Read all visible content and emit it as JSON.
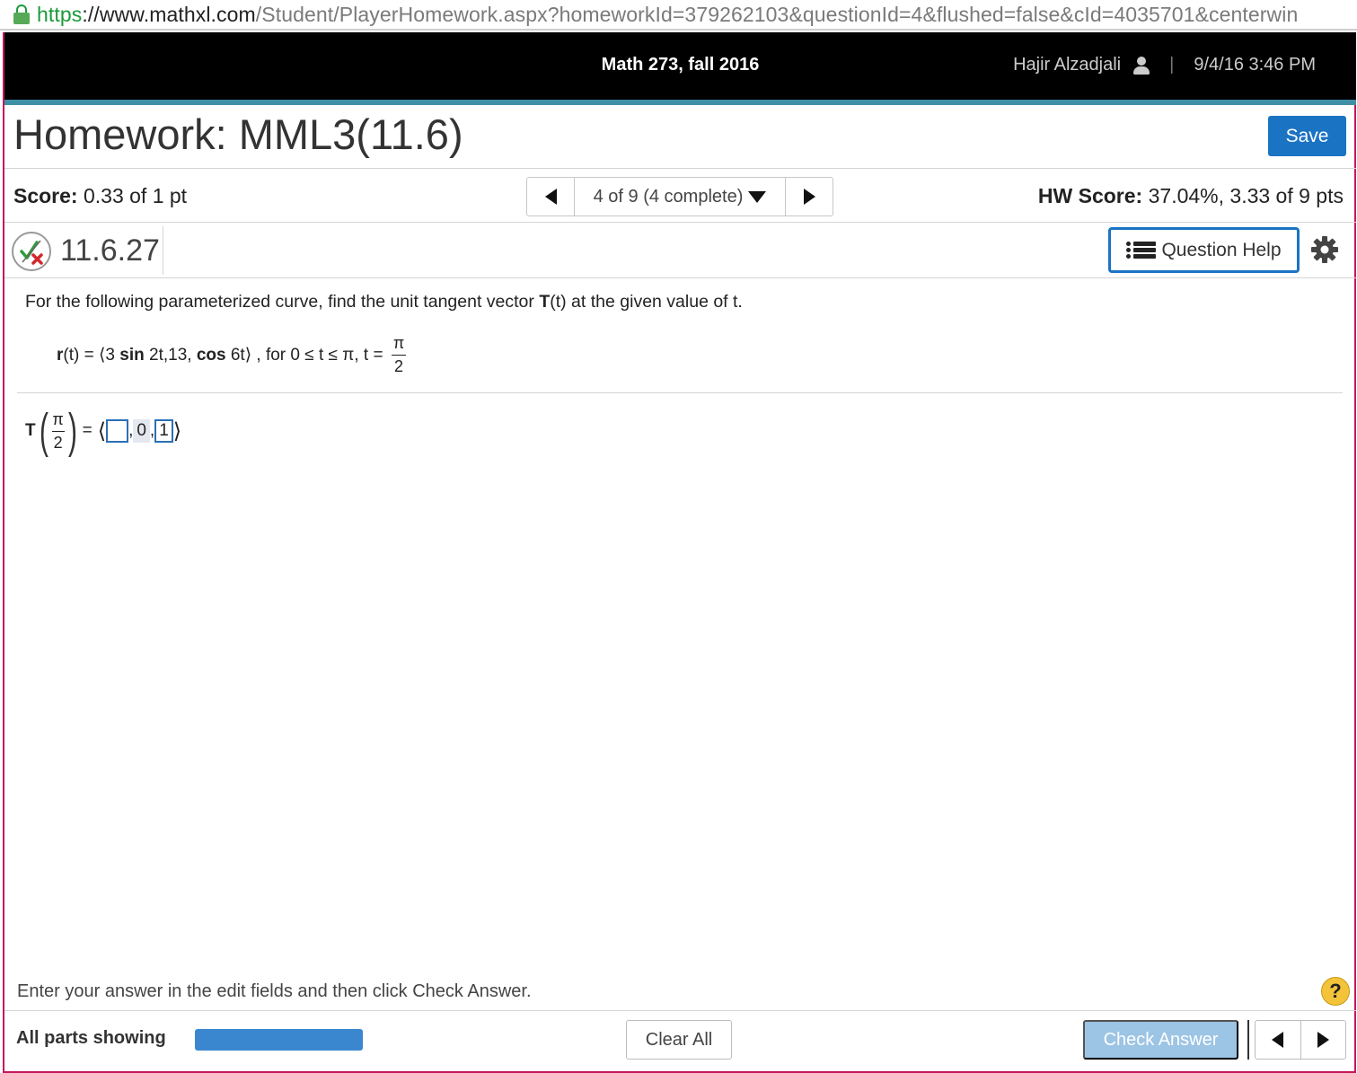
{
  "browser": {
    "url_proto": "https",
    "url_host": "://www.mathxl.com",
    "url_rest": "/Student/PlayerHomework.aspx?homeworkId=379262103&questionId=4&flushed=false&cId=4035701&centerwin"
  },
  "header": {
    "course": "Math 273, fall 2016",
    "user_name": "Hajir Alzadjali",
    "separator": "|",
    "datetime": "9/4/16 3:46 PM"
  },
  "homework": {
    "title": "Homework: MML3(11.6)",
    "save_label": "Save"
  },
  "score": {
    "label": "Score:",
    "value": "0.33 of 1 pt",
    "nav_label": "4 of 9 (4 complete)",
    "hw_label": "HW Score:",
    "hw_value": "37.04%, 3.33 of 9 pts"
  },
  "question": {
    "id": "11.6.27",
    "help_label": "Question Help",
    "prompt_before": "For the following parameterized curve, find the unit tangent vector ",
    "prompt_bold": "T",
    "prompt_after": "(t) at the given value of t.",
    "formula": {
      "r": "r",
      "part1": "(t) = ⟨3 ",
      "sin": "sin",
      "part2": " 2t,13, ",
      "cos": "cos",
      "part3": " 6t⟩ , for 0 ≤ t ≤ π, t = ",
      "frac_num": "π",
      "frac_den": "2"
    },
    "answer": {
      "T": "T",
      "frac_num": "π",
      "frac_den": "2",
      "equals": "=",
      "open": "⟨",
      "comma1": ",",
      "val2": "0",
      "comma2": ",",
      "val3": "1",
      "close": "⟩"
    }
  },
  "footer": {
    "instructions": "Enter your answer in the edit fields and then click Check Answer.",
    "help_symbol": "?",
    "parts_label": "All parts showing",
    "clear_label": "Clear All",
    "check_label": "Check Answer"
  },
  "colors": {
    "accent": "#1b73c4",
    "teal_bar": "#3f8fa6",
    "frame": "#c2185b"
  }
}
